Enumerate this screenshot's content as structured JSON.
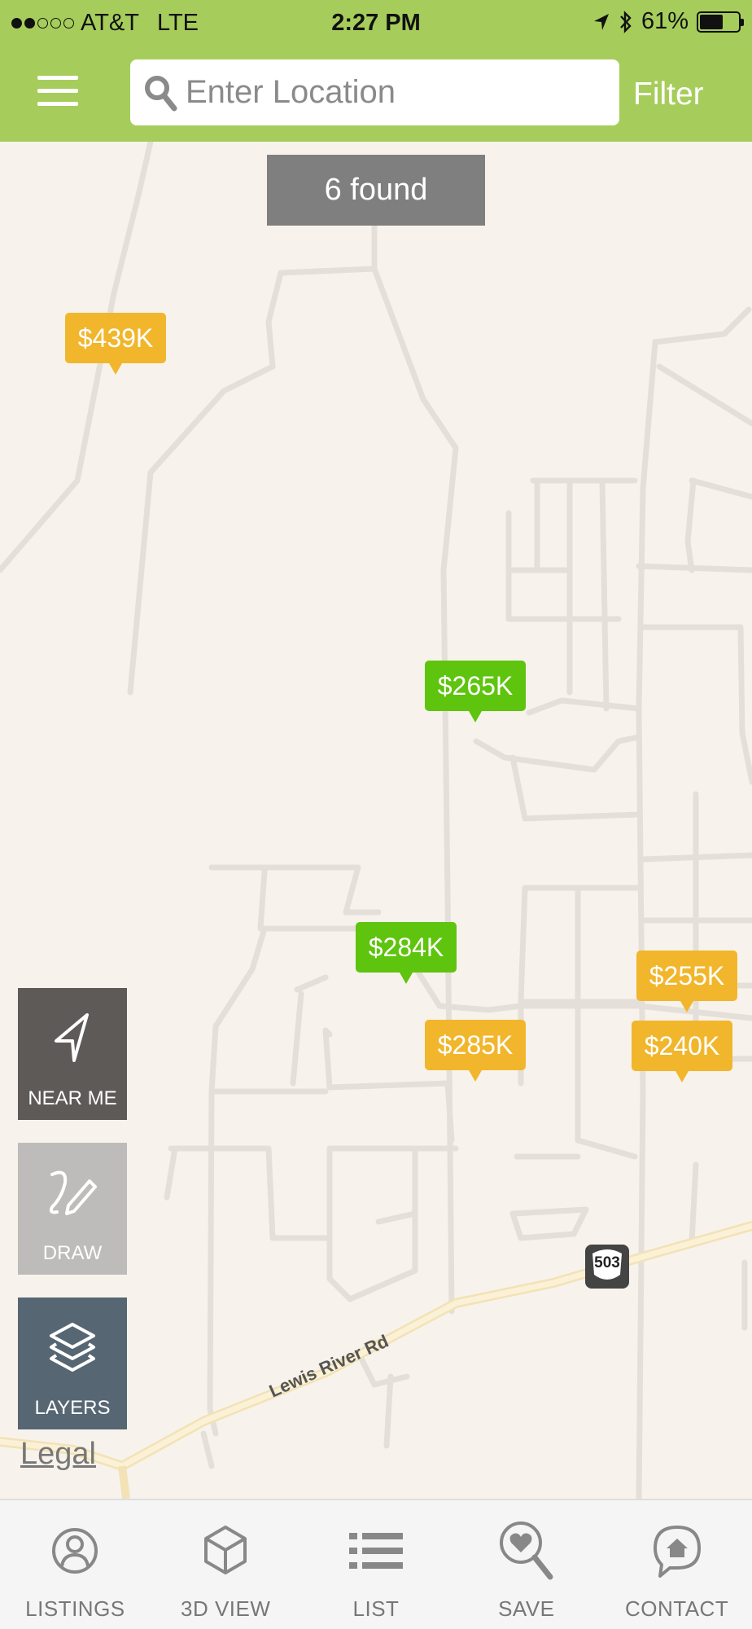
{
  "status_bar": {
    "carrier": "AT&T",
    "network": "LTE",
    "time": "2:27 PM",
    "battery": "61%",
    "battery_level": 0.61,
    "signal_bars": 2,
    "signal_total": 5
  },
  "header": {
    "search_placeholder": "Enter Location",
    "filter_label": "Filter",
    "bg_color": "#a6cd5b"
  },
  "map": {
    "found_text": "6 found",
    "markers": [
      {
        "price": "$439K",
        "color": "yellow"
      },
      {
        "price": "$265K",
        "color": "green"
      },
      {
        "price": "$284K",
        "color": "green"
      },
      {
        "price": "$285K",
        "color": "yellow"
      },
      {
        "price": "$255K",
        "color": "yellow"
      },
      {
        "price": "$240K",
        "color": "yellow"
      }
    ],
    "road_label": "Lewis River Rd",
    "route_number": "503",
    "legal_label": "Legal",
    "buttons": {
      "near_me": "NEAR ME",
      "draw": "DRAW",
      "layers": "LAYERS"
    }
  },
  "tab_bar": {
    "tabs": [
      {
        "label": "LISTINGS",
        "icon": "person-icon"
      },
      {
        "label": "3D VIEW",
        "icon": "cube-icon"
      },
      {
        "label": "LIST",
        "icon": "list-icon"
      },
      {
        "label": "SAVE",
        "icon": "heart-search-icon"
      },
      {
        "label": "CONTACT",
        "icon": "chat-home-icon"
      }
    ]
  },
  "colors": {
    "marker_yellow": "#f1b62c",
    "marker_green": "#5ec40d",
    "map_bg": "#f7f3ec"
  }
}
